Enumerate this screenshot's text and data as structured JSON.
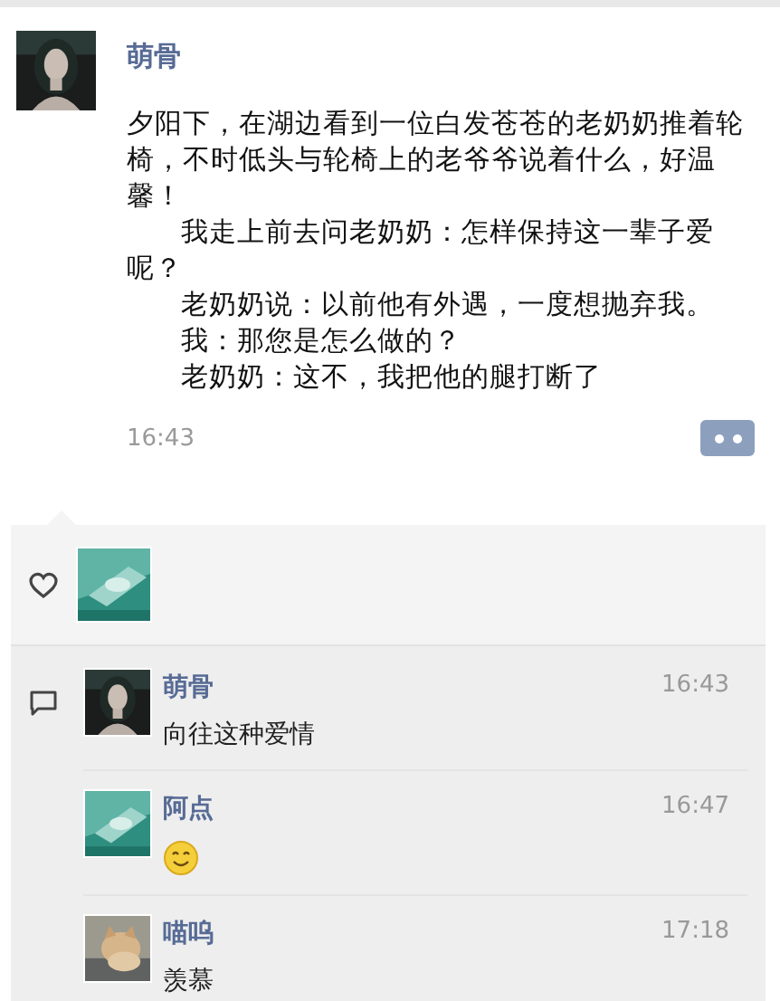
{
  "post": {
    "author": "萌骨",
    "paragraphs": [
      {
        "text": "夕阳下，在湖边看到一位白发苍苍的老奶奶推着轮椅，不时低头与轮椅上的老爷爷说着什么，好温馨！",
        "indented": false
      },
      {
        "text": "我走上前去问老奶奶：怎样保持这一辈子爱呢？",
        "indented": true
      },
      {
        "text": "老奶奶说：以前他有外遇，一度想抛弃我。",
        "indented": true
      },
      {
        "text": "我：那您是怎么做的？",
        "indented": true
      },
      {
        "text": "老奶奶：这不，我把他的腿打断了",
        "indented": true
      }
    ],
    "time": "16:43"
  },
  "comments": [
    {
      "author": "萌骨",
      "time": "16:43",
      "kind": "text",
      "text": "向往这种爱情"
    },
    {
      "author": "阿点",
      "time": "16:47",
      "kind": "emoji"
    },
    {
      "author": "喵呜",
      "time": "17:18",
      "kind": "text",
      "text": "羡慕"
    }
  ]
}
